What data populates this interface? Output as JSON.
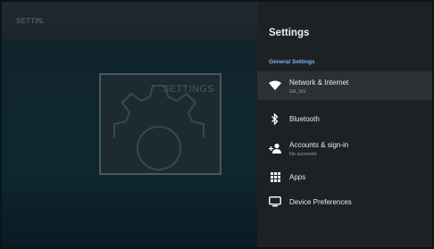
{
  "background": {
    "title": "SETTIN.",
    "tile_label": "SETTINGS"
  },
  "panel": {
    "title": "Settings",
    "section_header": "General Settings",
    "items": [
      {
        "label": "Network & Internet",
        "sublabel": "GK_5G",
        "icon": "wifi-icon",
        "focused": true
      },
      {
        "label": "Bluetooth",
        "icon": "bluetooth-icon"
      },
      {
        "label": "Accounts & sign-in",
        "sublabel": "No accounts",
        "icon": "add-account-icon"
      },
      {
        "label": "Apps",
        "icon": "apps-grid-icon"
      },
      {
        "label": "Device Preferences",
        "icon": "tv-monitor-icon"
      }
    ]
  },
  "colors": {
    "panel_bg": "#1e2124",
    "focused_bg": "#2c3034",
    "section_accent": "#7ab4ee",
    "text_primary": "#e8eaed",
    "text_secondary": "#9aa0a6"
  }
}
